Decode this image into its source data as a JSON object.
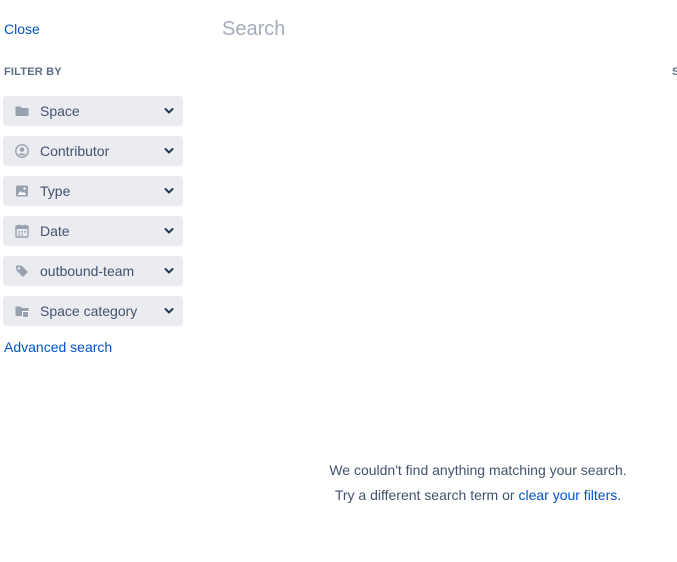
{
  "header": {
    "close_label": "Close",
    "search_placeholder": "Search",
    "search_value": ""
  },
  "filter_panel": {
    "heading": "FILTER BY",
    "filters": [
      {
        "label": "Space",
        "icon": "folder-icon"
      },
      {
        "label": "Contributor",
        "icon": "person-icon"
      },
      {
        "label": "Type",
        "icon": "image-icon"
      },
      {
        "label": "Date",
        "icon": "calendar-icon"
      },
      {
        "label": "outbound-team",
        "icon": "tag-icon"
      },
      {
        "label": "Space category",
        "icon": "folder-category-icon"
      }
    ],
    "advanced_search_label": "Advanced search"
  },
  "right_edge_text": "S",
  "empty_state": {
    "line1": "We couldn't find anything matching your search.",
    "line2_prefix": "Try a different search term or",
    "line2_link": "clear your filters",
    "line2_suffix": "."
  },
  "colors": {
    "link": "#0052cc",
    "filter_bg": "#ebecf0",
    "icon_gray": "#97a0af",
    "text": "#42526e"
  }
}
